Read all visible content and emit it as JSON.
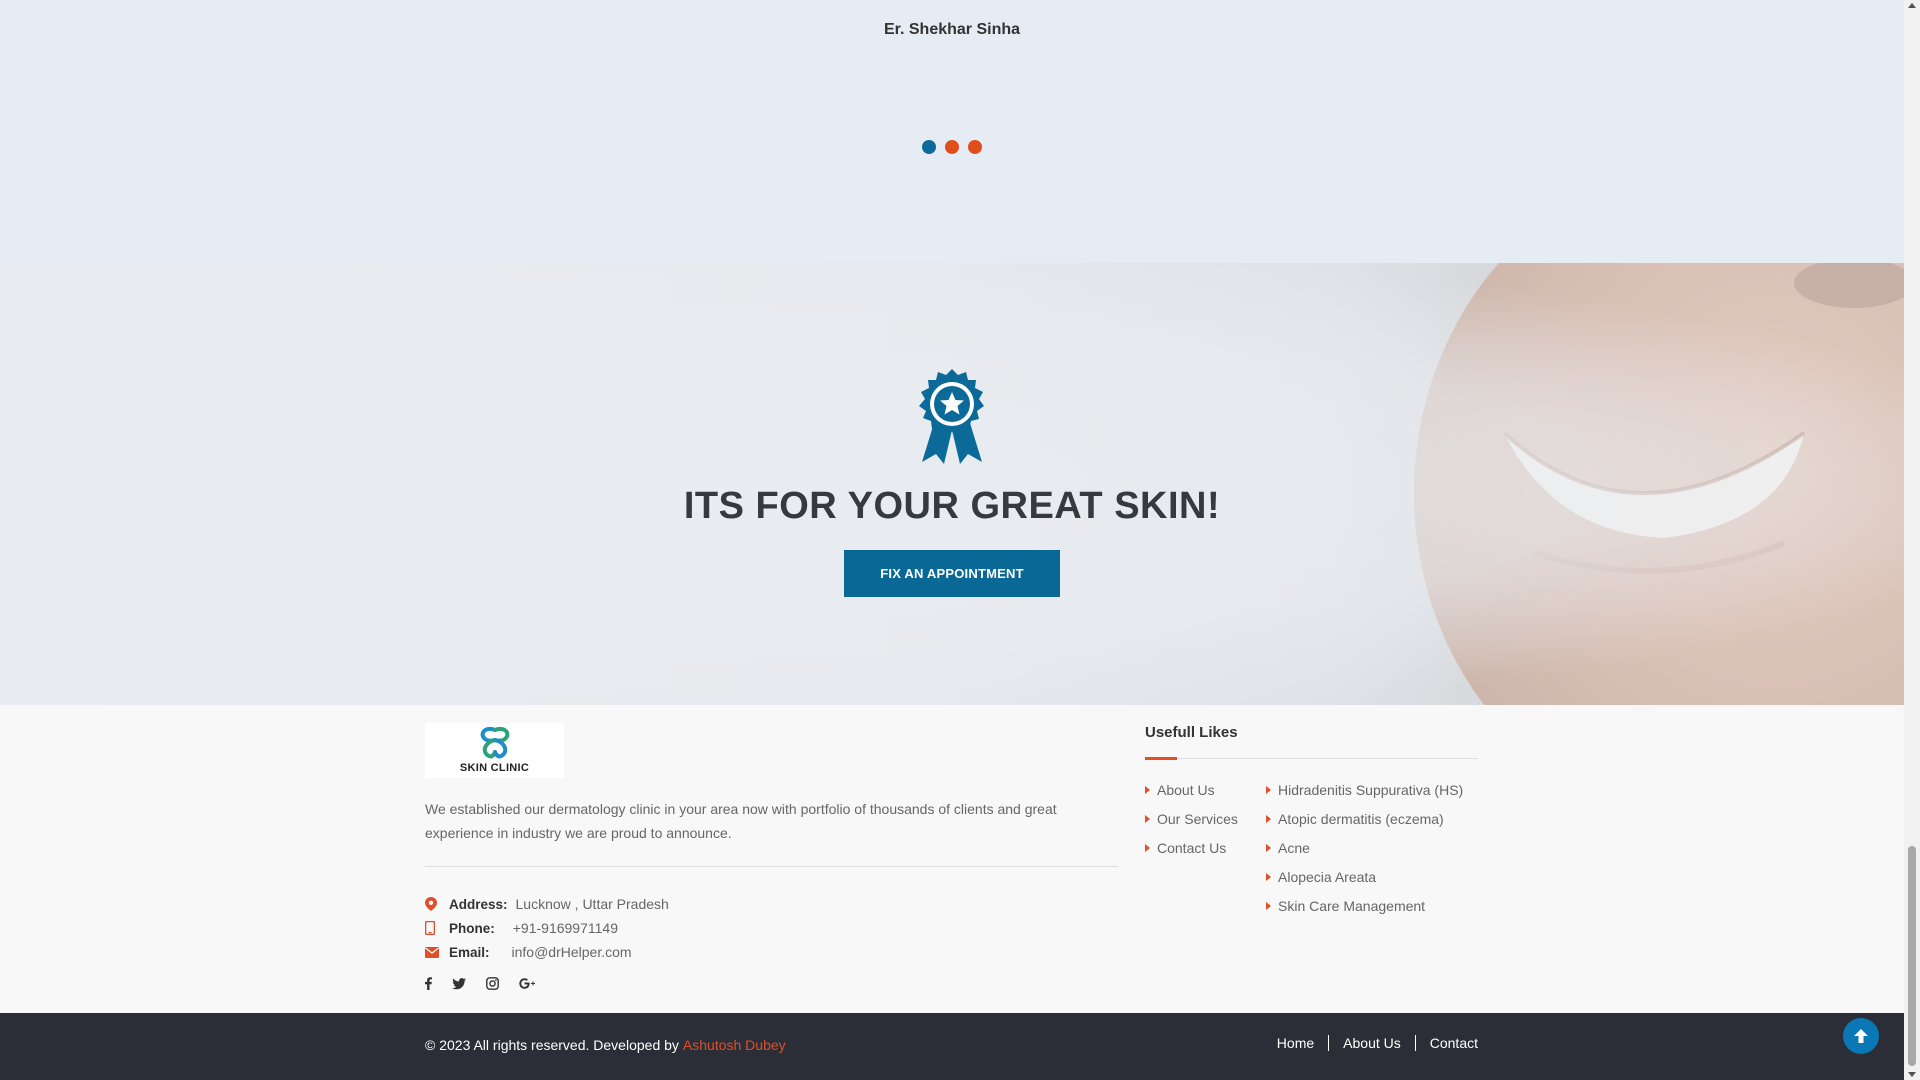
{
  "testimonial": {
    "author": "Er. Shekhar Sinha",
    "dots": [
      {
        "state": "active",
        "color": "#0d6a9a"
      },
      {
        "state": "inactive",
        "color": "#e04e1b"
      },
      {
        "state": "inactive",
        "color": "#e04e1b"
      }
    ]
  },
  "hero": {
    "icon": "award-ribbon-star-icon",
    "title": "ITS FOR YOUR GREAT SKIN!",
    "button_label": "FIX AN APPOINTMENT",
    "accent_color": "#096896"
  },
  "footer": {
    "logo_text": "SKIN CLINIC",
    "about": "We established our dermatology clinic in your area now with portfolio of thousands of clients and great experience in industry we are proud to announce.",
    "contact": {
      "address_label": "Address:",
      "address_value": "Lucknow , Uttar Pradesh",
      "phone_label": "Phone:",
      "phone_value": "+91-9169971149",
      "email_label": "Email:",
      "email_value": "info@drHelper.com"
    },
    "social_icons": [
      "facebook-icon",
      "twitter-icon",
      "instagram-icon",
      "google-plus-icon"
    ],
    "links_title": "Usefull Likes",
    "links_col1": [
      "About Us",
      "Our Services",
      "Contact Us"
    ],
    "links_col2": [
      "Hidradenitis Suppurativa (HS)",
      "Atopic dermatitis (eczema)",
      "Acne",
      "Alopecia Areata",
      "Skin Care Management"
    ],
    "accent_color": "#e04e2a"
  },
  "bottom_bar": {
    "copyright": "© 2023 All rights reserved. Developed by",
    "developer": "Ashutosh Dubey",
    "nav": [
      "Home",
      "About Us",
      "Contact"
    ]
  }
}
